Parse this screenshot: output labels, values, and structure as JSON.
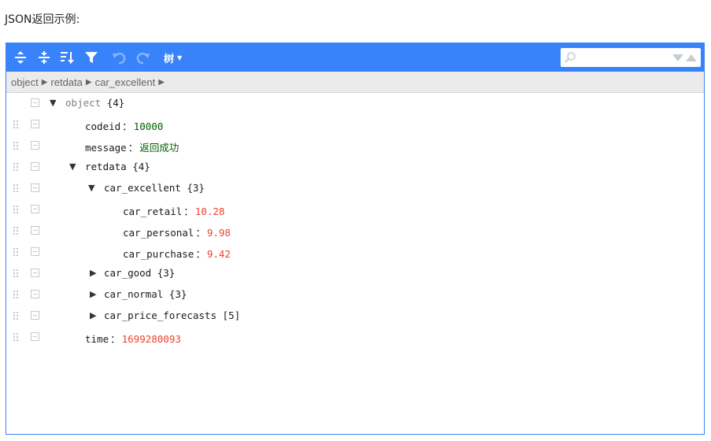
{
  "page": {
    "heading": "JSON返回示例:"
  },
  "toolbar": {
    "buttons": [
      {
        "name": "expand-all-icon",
        "enabled": true
      },
      {
        "name": "collapse-all-icon",
        "enabled": true
      },
      {
        "name": "sort-icon",
        "enabled": true
      },
      {
        "name": "filter-icon",
        "enabled": true
      },
      {
        "name": "undo-icon",
        "enabled": false
      },
      {
        "name": "redo-icon",
        "enabled": false
      }
    ],
    "mode_label": "树",
    "search_value": "",
    "accent": "#3883fa"
  },
  "breadcrumb": {
    "items": [
      "object",
      "retdata",
      "car_excellent"
    ]
  },
  "tree": {
    "root": {
      "key": "object",
      "count": "{4}"
    },
    "codeid": {
      "key": "codeid",
      "value": "10000"
    },
    "message": {
      "key": "message",
      "value": "返回成功"
    },
    "retdata": {
      "key": "retdata",
      "count": "{4}"
    },
    "car_excellent": {
      "key": "car_excellent",
      "count": "{3}"
    },
    "car_retail": {
      "key": "car_retail",
      "value": "10.28"
    },
    "car_personal": {
      "key": "car_personal",
      "value": "9.98"
    },
    "car_purchase": {
      "key": "car_purchase",
      "value": "9.42"
    },
    "car_good": {
      "key": "car_good",
      "count": "{3}"
    },
    "car_normal": {
      "key": "car_normal",
      "count": "{3}"
    },
    "car_price_forecasts": {
      "key": "car_price_forecasts",
      "count": "[5]"
    },
    "time": {
      "key": "time",
      "value": "1699280093"
    },
    "colon": "："
  }
}
